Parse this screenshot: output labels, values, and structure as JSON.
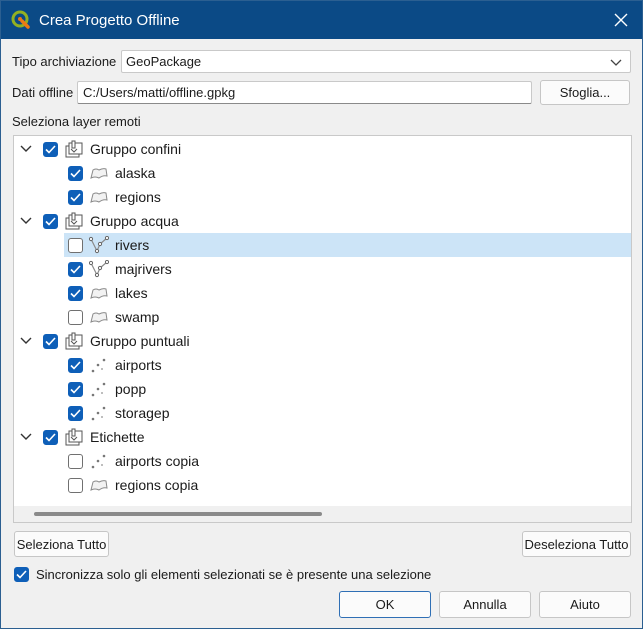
{
  "window": {
    "title": "Crea Progetto Offline"
  },
  "storage": {
    "label": "Tipo archiviazione",
    "value": "GeoPackage"
  },
  "offline_data": {
    "label": "Dati offline",
    "value": "C:/Users/matti/offline.gpkg",
    "browse_label": "Sfoglia..."
  },
  "tree": {
    "label": "Seleziona layer remoti",
    "rows": [
      {
        "label": "Gruppo confini",
        "type": "group",
        "checked": true,
        "expanded": true
      },
      {
        "label": "alaska",
        "type": "polygon",
        "checked": true
      },
      {
        "label": "regions",
        "type": "polygon",
        "checked": true
      },
      {
        "label": "Gruppo acqua",
        "type": "group",
        "checked": true,
        "expanded": true
      },
      {
        "label": "rivers",
        "type": "line",
        "checked": false,
        "selected": true
      },
      {
        "label": "majrivers",
        "type": "line",
        "checked": true
      },
      {
        "label": "lakes",
        "type": "polygon",
        "checked": true
      },
      {
        "label": "swamp",
        "type": "polygon",
        "checked": false
      },
      {
        "label": "Gruppo puntuali",
        "type": "group",
        "checked": true,
        "expanded": true
      },
      {
        "label": "airports",
        "type": "point",
        "checked": true
      },
      {
        "label": "popp",
        "type": "point",
        "checked": true
      },
      {
        "label": "storagep",
        "type": "point",
        "checked": true
      },
      {
        "label": "Etichette",
        "type": "group",
        "checked": true,
        "expanded": true
      },
      {
        "label": "airports copia",
        "type": "point",
        "checked": false
      },
      {
        "label": "regions copia",
        "type": "polygon",
        "checked": false
      }
    ]
  },
  "buttons": {
    "select_all": "Seleziona Tutto",
    "deselect_all": "Deseleziona Tutto",
    "ok": "OK",
    "cancel": "Annulla",
    "help": "Aiuto"
  },
  "sync": {
    "label": "Sincronizza solo gli elementi selezionati se è presente una selezione",
    "checked": true
  },
  "colors": {
    "titlebar": "#0b4a86",
    "accent": "#0e5fb8",
    "selection": "#cce4f7"
  }
}
